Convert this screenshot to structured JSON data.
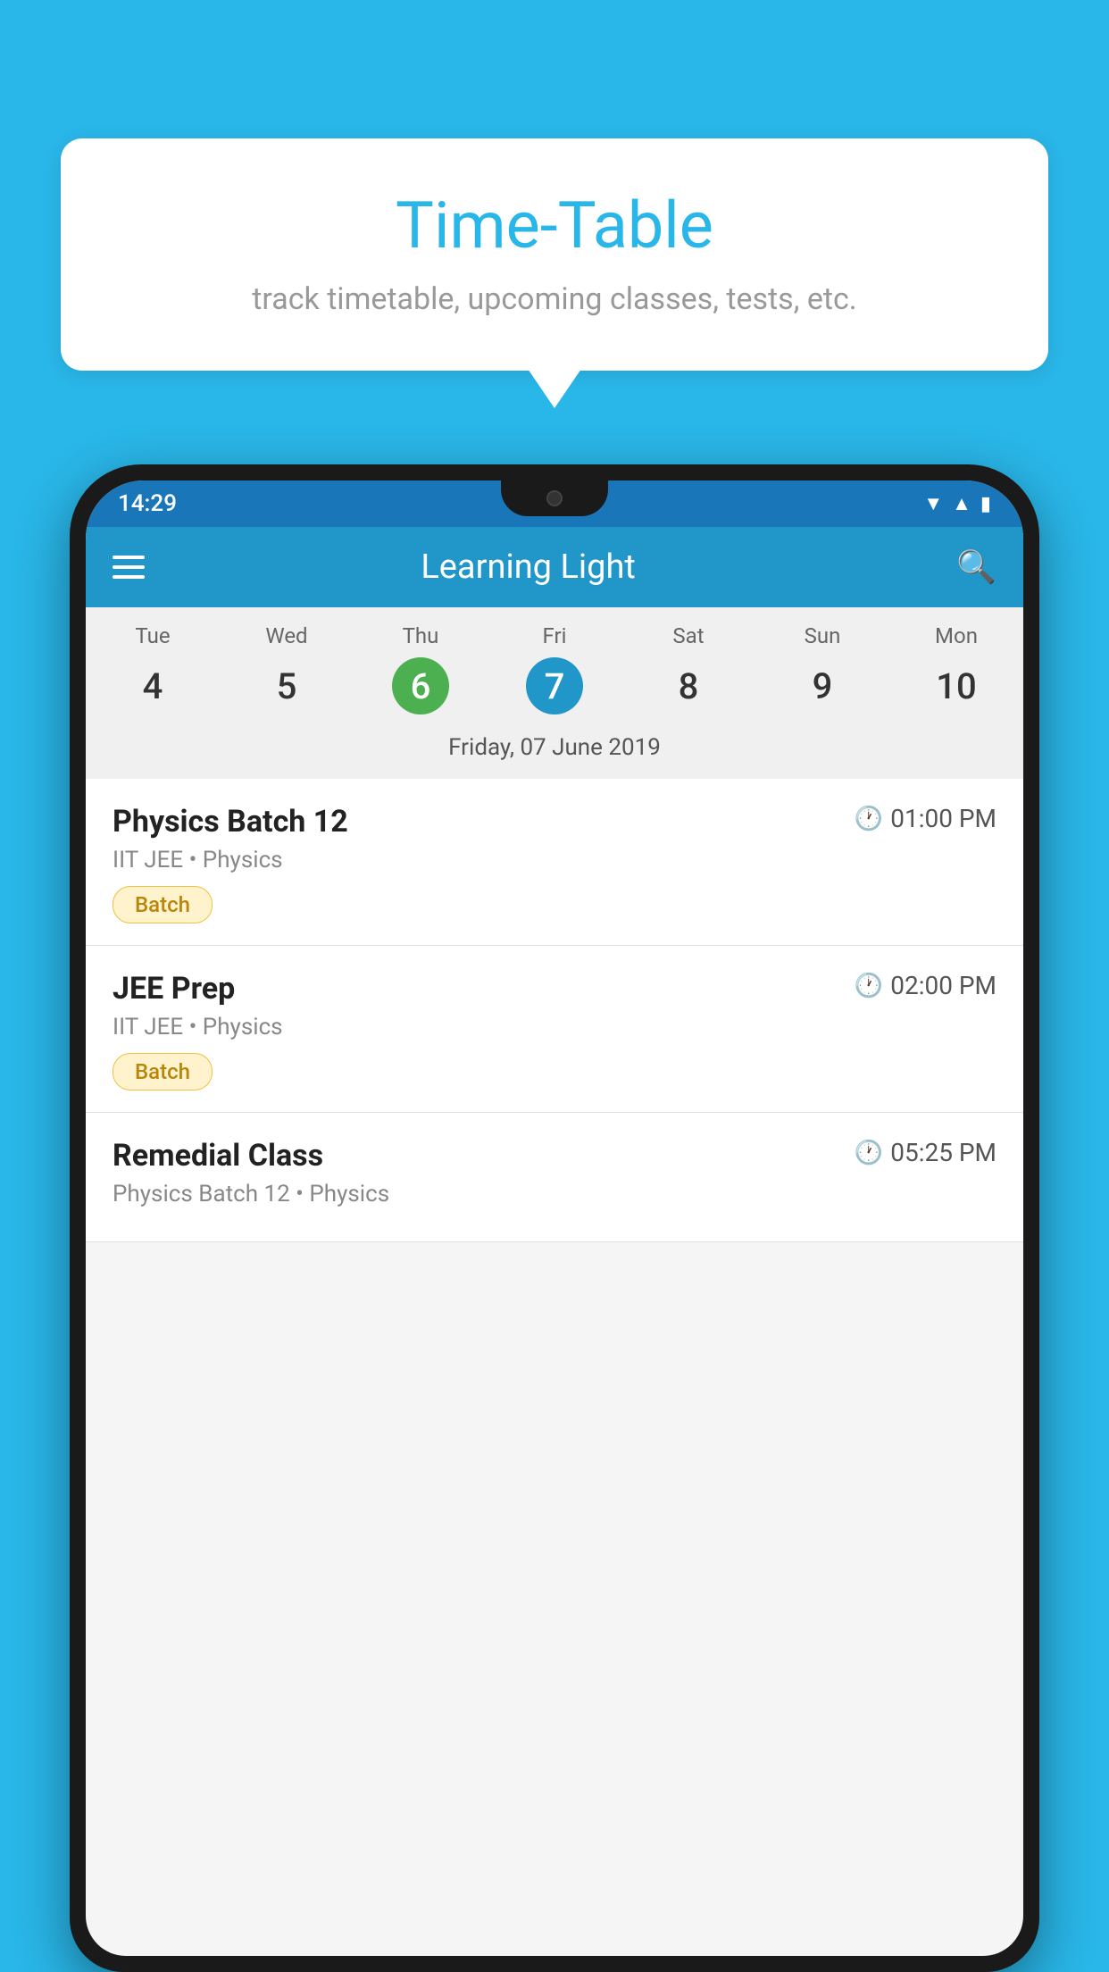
{
  "background_color": "#29b6e8",
  "tooltip": {
    "title": "Time-Table",
    "subtitle": "track timetable, upcoming classes, tests, etc."
  },
  "phone": {
    "status_bar": {
      "time": "14:29",
      "icons": [
        "wifi",
        "signal",
        "battery"
      ]
    },
    "app_bar": {
      "title": "Learning Light",
      "menu_icon": "hamburger-icon",
      "search_icon": "search-icon"
    },
    "calendar": {
      "days": [
        {
          "name": "Tue",
          "num": "4",
          "state": "normal"
        },
        {
          "name": "Wed",
          "num": "5",
          "state": "normal"
        },
        {
          "name": "Thu",
          "num": "6",
          "state": "today"
        },
        {
          "name": "Fri",
          "num": "7",
          "state": "selected"
        },
        {
          "name": "Sat",
          "num": "8",
          "state": "normal"
        },
        {
          "name": "Sun",
          "num": "9",
          "state": "normal"
        },
        {
          "name": "Mon",
          "num": "10",
          "state": "normal"
        }
      ],
      "selected_date_label": "Friday, 07 June 2019"
    },
    "schedule": [
      {
        "title": "Physics Batch 12",
        "time": "01:00 PM",
        "subtitle": "IIT JEE • Physics",
        "badge": "Batch"
      },
      {
        "title": "JEE Prep",
        "time": "02:00 PM",
        "subtitle": "IIT JEE • Physics",
        "badge": "Batch"
      },
      {
        "title": "Remedial Class",
        "time": "05:25 PM",
        "subtitle": "Physics Batch 12 • Physics",
        "badge": null
      }
    ]
  }
}
